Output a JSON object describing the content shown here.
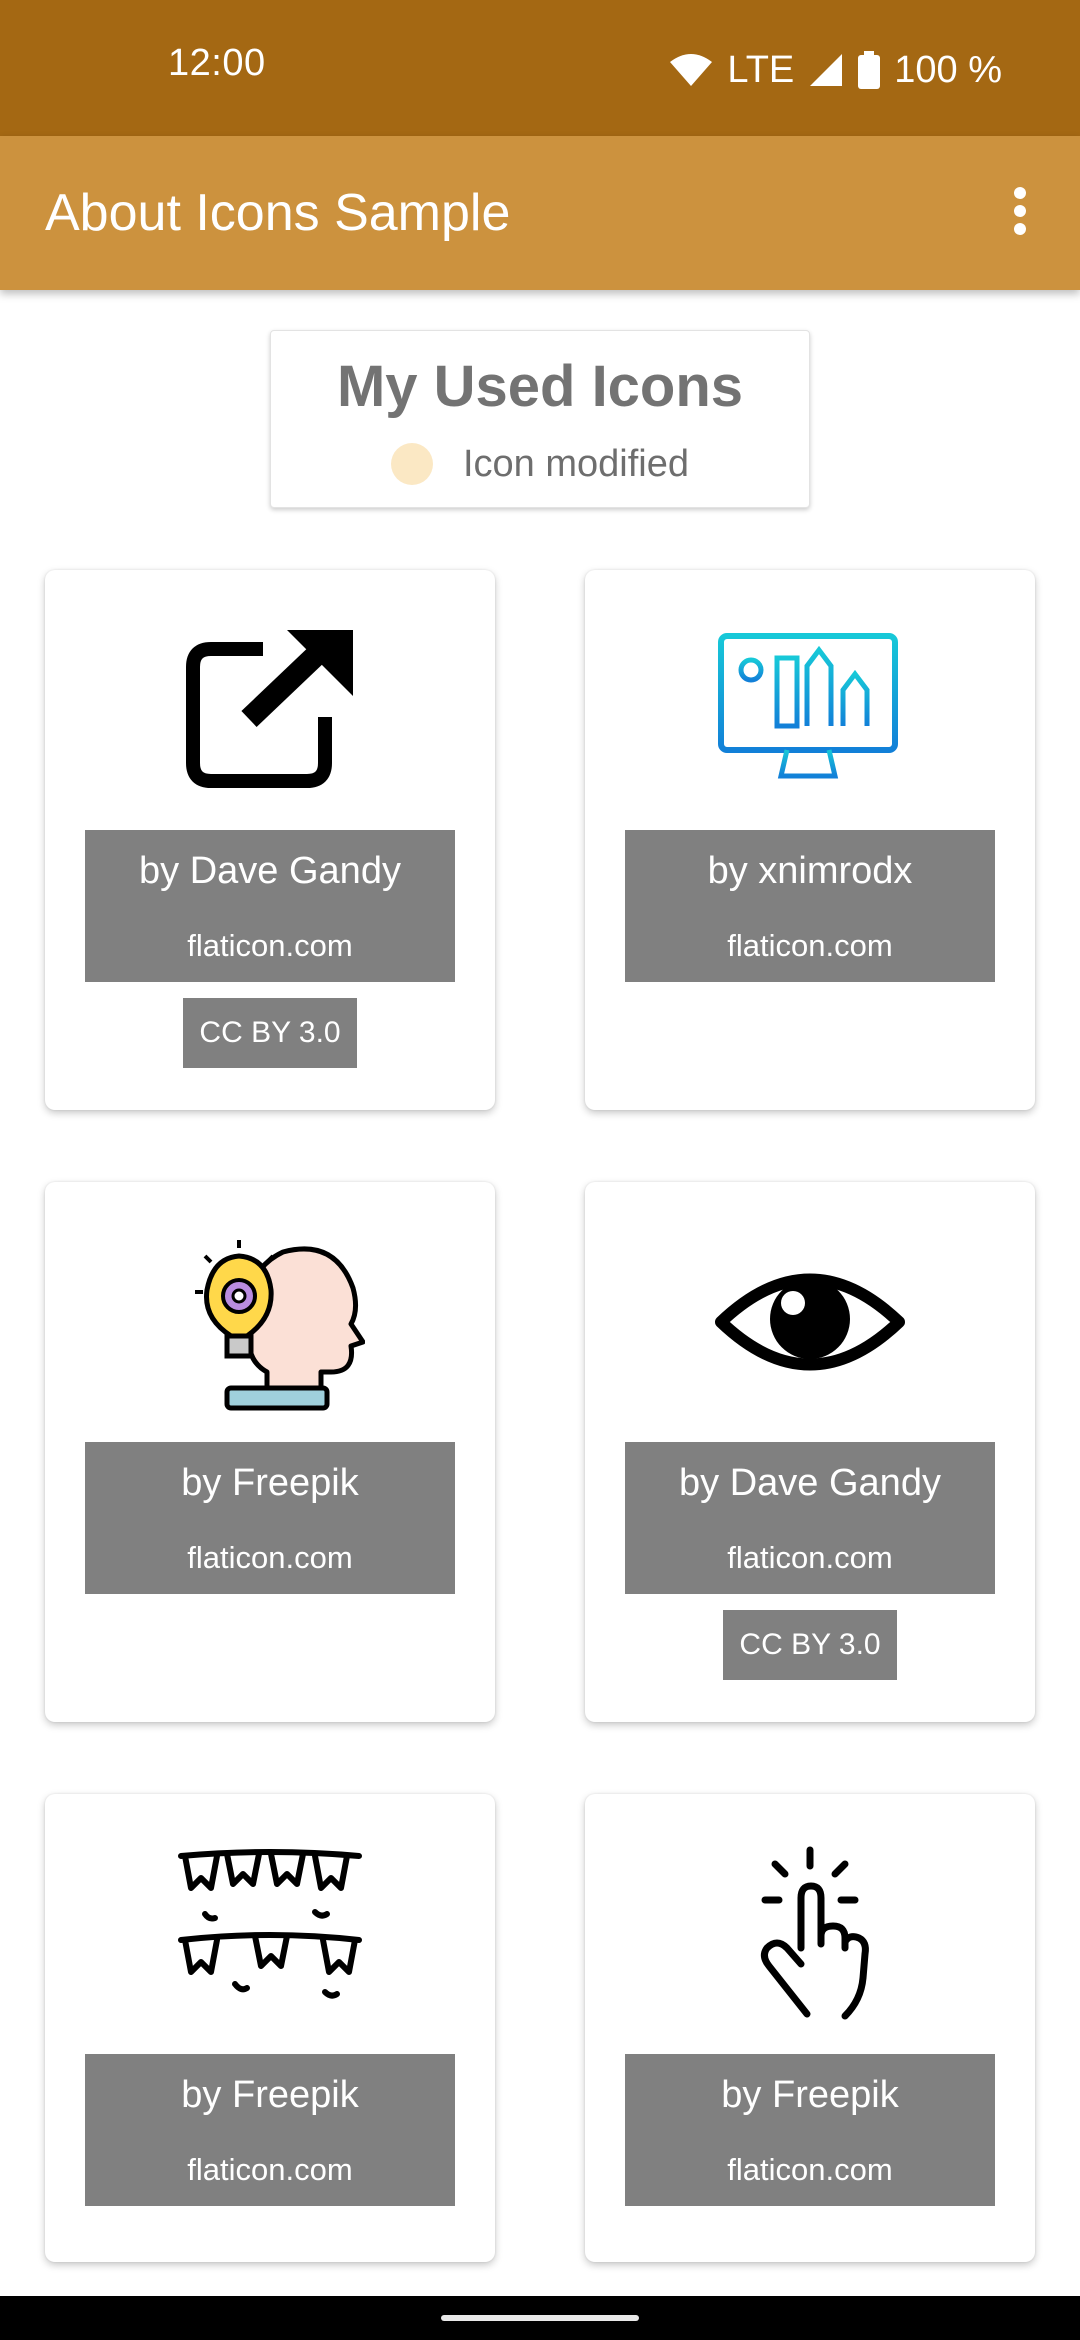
{
  "status_bar": {
    "time": "12:00",
    "network": "LTE",
    "battery": "100 %",
    "icons": [
      "wifi-icon",
      "signal-icon",
      "battery-icon"
    ]
  },
  "app_bar": {
    "title": "About Icons Sample",
    "menu_icon": "more-vert-icon"
  },
  "legend": {
    "title": "My Used Icons",
    "modified_label": "Icon modified",
    "modified_color": "#fbe8c4"
  },
  "cards": [
    {
      "icon": "external-link-icon",
      "author": "by Dave Gandy",
      "site": "flaticon.com",
      "license": "CC BY 3.0"
    },
    {
      "icon": "design-monitor-icon",
      "author": "by xnimrodx",
      "site": "flaticon.com"
    },
    {
      "icon": "idea-head-icon",
      "author": "by Freepik",
      "site": "flaticon.com"
    },
    {
      "icon": "eye-icon",
      "author": "by Dave Gandy",
      "site": "flaticon.com",
      "license": "CC BY 3.0"
    },
    {
      "icon": "bunting-flags-icon",
      "author": "by Freepik",
      "site": "flaticon.com"
    },
    {
      "icon": "tap-gesture-icon",
      "author": "by Freepik",
      "site": "flaticon.com"
    }
  ],
  "colors": {
    "status_bar": "#a46813",
    "app_bar": "#cc923e",
    "attribution_bg": "#808080"
  }
}
